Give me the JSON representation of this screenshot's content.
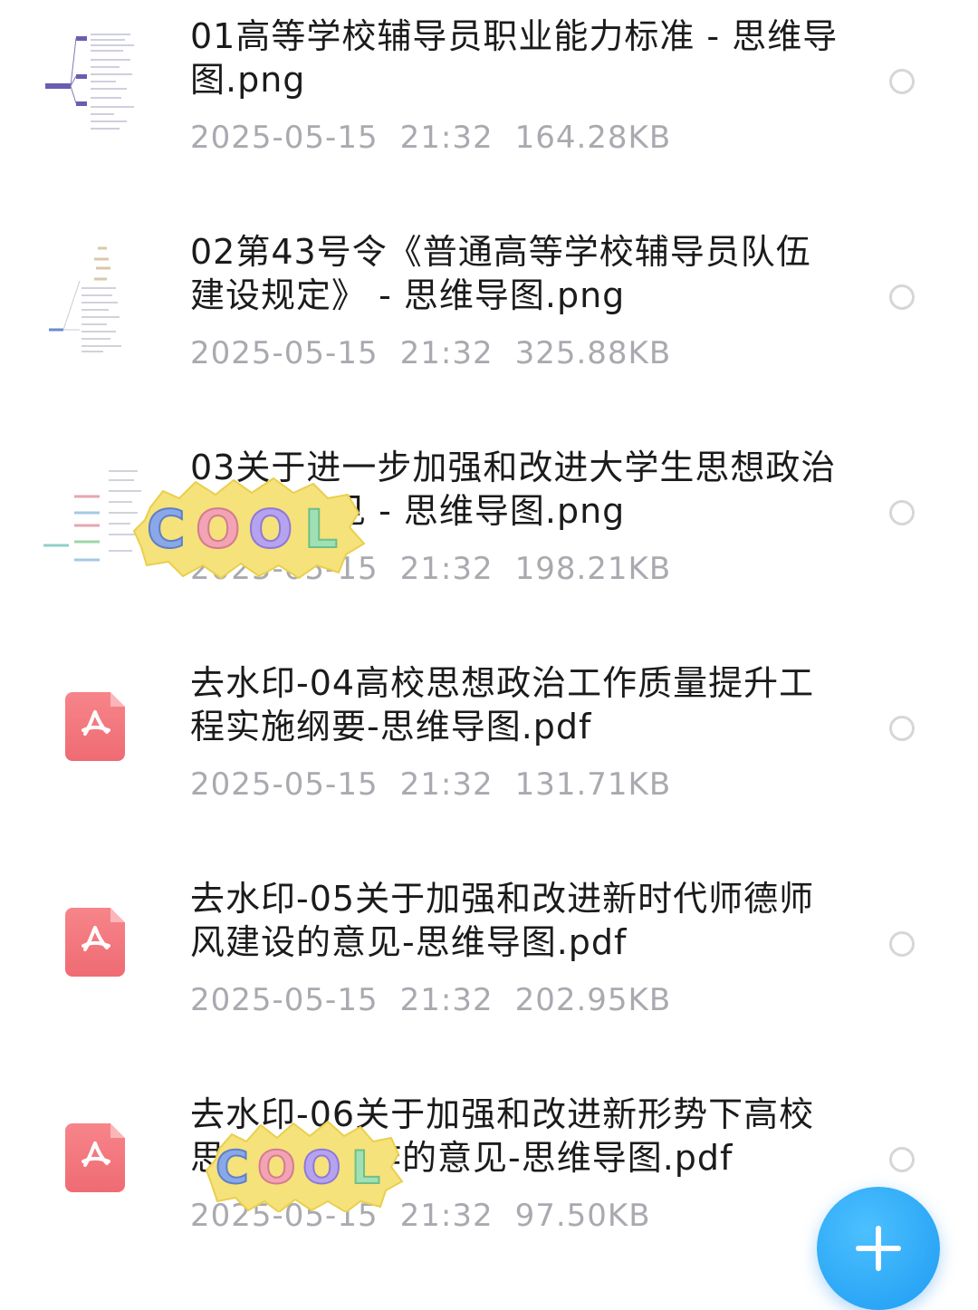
{
  "files": [
    {
      "name": "01高等学校辅导员职业能力标准 - 思维导图.png",
      "date": "2025-05-15",
      "time": "21:32",
      "size": "164.28KB",
      "type": "image"
    },
    {
      "name": "02第43号令《普通高等学校辅导员队伍建设规定》 - 思维导图.png",
      "date": "2025-05-15",
      "time": "21:32",
      "size": "325.88KB",
      "type": "image"
    },
    {
      "name": "03关于进一步加强和改进大学生思想政治教育的意见 - 思维导图.png",
      "date": "2025-05-15",
      "time": "21:32",
      "size": "198.21KB",
      "type": "image"
    },
    {
      "name": "去水印-04高校思想政治工作质量提升工程实施纲要-思维导图.pdf",
      "date": "2025-05-15",
      "time": "21:32",
      "size": "131.71KB",
      "type": "pdf"
    },
    {
      "name": "去水印-05关于加强和改进新时代师德师风建设的意见-思维导图.pdf",
      "date": "2025-05-15",
      "time": "21:32",
      "size": "202.95KB",
      "type": "pdf"
    },
    {
      "name": "去水印-06关于加强和改进新形势下高校思想政治工作的意见-思维导图.pdf",
      "date": "2025-05-15",
      "time": "21:32",
      "size": "97.50KB",
      "type": "pdf"
    }
  ],
  "sticker_text": "COOL",
  "icons": {
    "pdf": "pdf-file-icon",
    "thumbnail": "mindmap-thumbnail",
    "add": "plus-icon",
    "select": "radio-circle-icon"
  },
  "colors": {
    "pdf_red": "#ef6b73",
    "fab_blue": "#1e9cf2",
    "meta_gray": "#a9aab0"
  }
}
